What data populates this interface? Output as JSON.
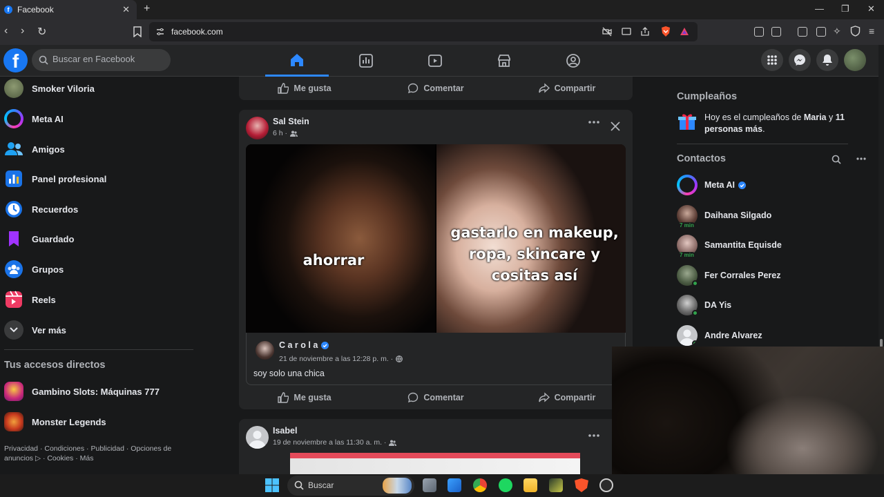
{
  "browser": {
    "tab_title": "Facebook",
    "url": "facebook.com"
  },
  "header": {
    "search_placeholder": "Buscar en Facebook"
  },
  "left_sidebar": {
    "items": [
      {
        "label": "Smoker Viloria",
        "icon": "profile-avatar"
      },
      {
        "label": "Meta AI",
        "icon": "meta-ai-icon"
      },
      {
        "label": "Amigos",
        "icon": "friends-icon"
      },
      {
        "label": "Panel profesional",
        "icon": "dashboard-icon"
      },
      {
        "label": "Recuerdos",
        "icon": "memories-icon"
      },
      {
        "label": "Guardado",
        "icon": "saved-icon"
      },
      {
        "label": "Grupos",
        "icon": "groups-icon"
      },
      {
        "label": "Reels",
        "icon": "reels-icon"
      },
      {
        "label": "Ver más",
        "icon": "chevron-down-icon"
      }
    ],
    "shortcuts_title": "Tus accesos directos",
    "shortcuts": [
      {
        "label": "Gambino Slots: Máquinas 777"
      },
      {
        "label": "Monster Legends"
      }
    ],
    "footer": "Privacidad · Condiciones · Publicidad · Opciones de anuncios ▷ · Cookies · Más"
  },
  "feed": {
    "actions": {
      "like": "Me gusta",
      "comment": "Comentar",
      "share": "Compartir"
    },
    "post1": {
      "author": "Sal Stein",
      "time": "6 h ·",
      "meme_left_text": "ahorrar",
      "meme_right_text": "gastarlo en makeup, ropa, skincare y cositas así",
      "shared_author": "C a r o l a",
      "shared_time": "21 de noviembre a las 12:28 p. m. ·",
      "shared_text": "soy solo una chica"
    },
    "post2": {
      "author": "Isabel",
      "time": "19 de noviembre a las 11:30 a. m. ·"
    }
  },
  "right_sidebar": {
    "birthdays_title": "Cumpleaños",
    "birthday_text_pre": "Hoy es el cumpleaños de ",
    "birthday_name": "Maria",
    "birthday_text_mid": " y ",
    "birthday_others": "11 personas más",
    "birthday_text_end": ".",
    "contacts_title": "Contactos",
    "contacts": [
      {
        "name": "Meta AI",
        "verified": true
      },
      {
        "name": "Daihana Silgado",
        "minutes": "7 min"
      },
      {
        "name": "Samantita Equisde",
        "minutes": "7 min"
      },
      {
        "name": "Fer Corrales Perez",
        "online": true
      },
      {
        "name": "DA Yis",
        "online": true
      },
      {
        "name": "Andre Alvarez",
        "online": true
      }
    ]
  },
  "taskbar": {
    "search_label": "Buscar"
  },
  "colors": {
    "accent": "#2d88ff",
    "facebook_blue": "#1877f2",
    "background": "#18191a",
    "card": "#242526"
  }
}
